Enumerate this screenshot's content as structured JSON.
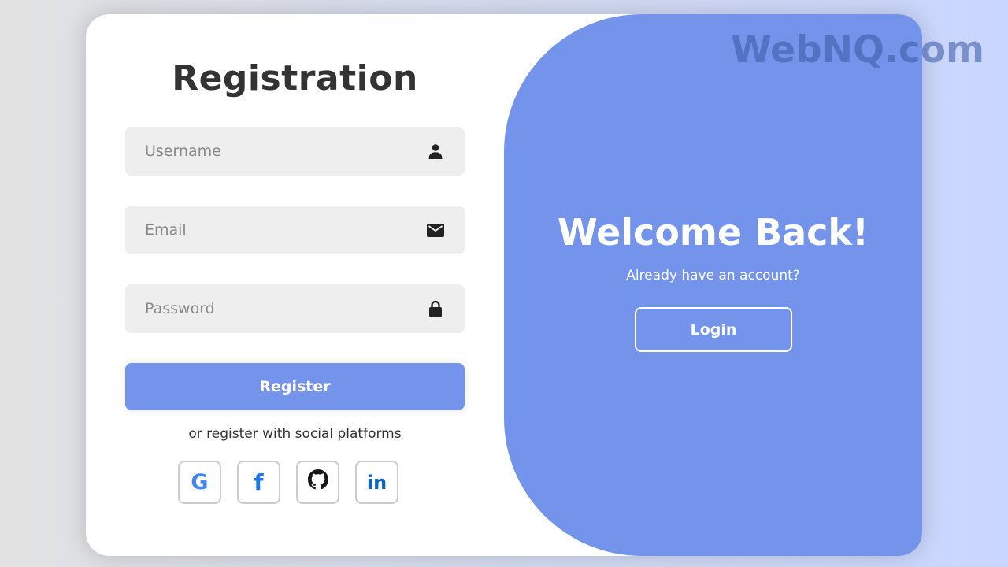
{
  "form": {
    "title": "Registration",
    "fields": [
      {
        "placeholder": "Username",
        "value": "",
        "icon": "user-icon"
      },
      {
        "placeholder": "Email",
        "value": "",
        "icon": "envelope-icon"
      },
      {
        "placeholder": "Password",
        "value": "",
        "icon": "lock-icon"
      }
    ],
    "register_label": "Register",
    "social_text": "or register with social platforms",
    "social": [
      {
        "name": "google-icon",
        "glyph": "G",
        "color": "#4285f4"
      },
      {
        "name": "facebook-icon",
        "glyph": "f",
        "color": "#1877f2"
      },
      {
        "name": "github-icon",
        "glyph": "",
        "color": "#181717"
      },
      {
        "name": "linkedin-icon",
        "glyph": "in",
        "color": "#0a66c2"
      }
    ]
  },
  "toggle": {
    "title": "Welcome Back!",
    "text": "Already have an account?",
    "login_label": "Login"
  },
  "watermark": "WebNQ.com",
  "colors": {
    "accent": "#7494ec",
    "input_bg": "#eeeeee",
    "title_text": "#333333"
  }
}
